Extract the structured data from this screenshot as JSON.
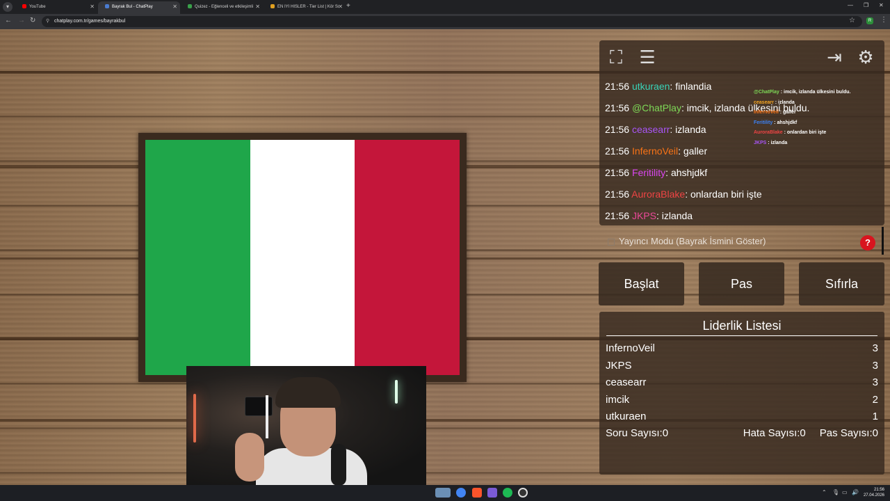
{
  "browser": {
    "tabs": [
      {
        "title": "YouTube",
        "active": false,
        "color": "#ff0000"
      },
      {
        "title": "Bayrak Bul - ChatPlay",
        "active": true,
        "color": "#4a7bd0"
      },
      {
        "title": "Quizez - Eğlenceli ve etkileşimli",
        "active": false,
        "color": "#3aa04a"
      },
      {
        "title": "EN IYI HISLER - Tier List | Kör Sı",
        "active": false,
        "color": "#e0a020"
      }
    ],
    "url": "chatplay.com.tr/games/bayrakbul"
  },
  "flag": {
    "colors": [
      "#1fa64a",
      "#ffffff",
      "#c4163a"
    ]
  },
  "toolbar": {
    "fullscreen_icon": "fullscreen-icon",
    "list_icon": "list-icon",
    "exit_icon": "exit-icon",
    "settings_icon": "gear-icon"
  },
  "chat": [
    {
      "time": "21:56",
      "user": "utkuraen",
      "color": "#39d4b8",
      "text": ": finlandia"
    },
    {
      "time": "21:56",
      "user": "@ChatPlay",
      "color": "#7ed957",
      "text": ": imcik, izlanda ülkesini buldu."
    },
    {
      "time": "21:56",
      "user": "ceasearr",
      "color": "#a855f7",
      "text": ": izlanda"
    },
    {
      "time": "21:56",
      "user": "InfernoVeil",
      "color": "#f97316",
      "text": ": galler"
    },
    {
      "time": "21:56",
      "user": "Feritility",
      "color": "#d946ef",
      "text": ": ahshjdkf"
    },
    {
      "time": "21:56",
      "user": "AuroraBlake",
      "color": "#ef4444",
      "text": ": onlardan biri işte"
    },
    {
      "time": "21:56",
      "user": "JKPS",
      "color": "#ec4899",
      "text": ": izlanda"
    }
  ],
  "overlay_chat": [
    {
      "user": "@ChatPlay",
      "color": "#7ed957",
      "text": ": imcik, izlanda ülkesini buldu."
    },
    {
      "user": "ceasearr",
      "color": "#f5a623",
      "text": ": izlanda"
    },
    {
      "user": "InfernoVeil",
      "color": "#f97316",
      "text": ": galler"
    },
    {
      "user": "Feritility",
      "color": "#3b82f6",
      "text": ": ahshjdkf"
    },
    {
      "user": "AuroraBlake",
      "color": "#ef4444",
      "text": ": onlardan biri işte"
    },
    {
      "user": "JKPS",
      "color": "#a855f7",
      "text": ": izlanda"
    }
  ],
  "streamer_mode": {
    "label": "Yayıncı Modu (Bayrak İsmini Göster)",
    "checked": false,
    "help": "?"
  },
  "actions": {
    "start": "Başlat",
    "pass": "Pas",
    "reset": "Sıfırla"
  },
  "leaderboard": {
    "title": "Liderlik Listesi",
    "rows": [
      {
        "name": "InfernoVeil",
        "score": "3"
      },
      {
        "name": "JKPS",
        "score": "3"
      },
      {
        "name": "ceasearr",
        "score": "3"
      },
      {
        "name": "imcik",
        "score": "2"
      },
      {
        "name": "utkuraen",
        "score": "1"
      }
    ],
    "questions": "Soru Sayısı:0",
    "errors": "Hata Sayısı:0",
    "passes": "Pas Sayısı:0"
  },
  "taskbar": {
    "time": "21:56",
    "date": "27.04.2026"
  }
}
